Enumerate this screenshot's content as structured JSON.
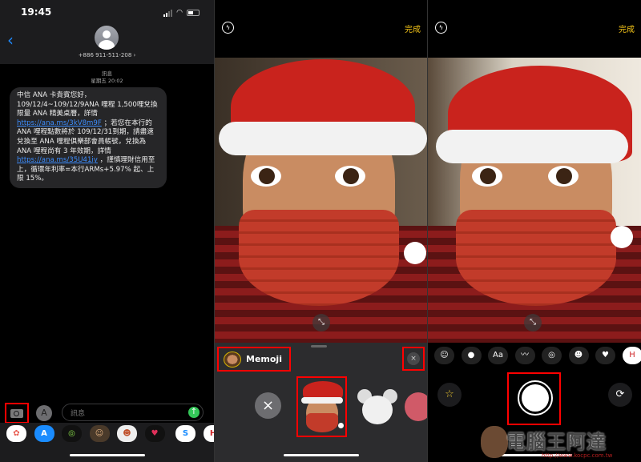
{
  "status_bar": {
    "time": "19:45"
  },
  "conversation": {
    "phone": "+886 911-511-208 ›",
    "back": "‹",
    "service": "訊息",
    "timestamp": "星期五 20:02"
  },
  "message": {
    "p1": "中信 ANA 卡貴賓您好，109/12/4~109/12/9ANA 哩程 1,500哩兌換限量 ANA 精美桌曆，詳情 ",
    "link1": "https://ana.ms/3kV8m9F",
    "p2": " ；若您在本行的ANA 哩程點數將於 109/12/31到期，請盡速兌換至 ANA 哩程俱樂部會員帳號，兌換為 ANA 哩程尚有 3 年效期，詳情 ",
    "link2": "https://ana.ms/35U41iy",
    "p3": " ，謹慎理財信用至上，循環年利率=本行ARMs+5.97% 起、上限 15%。"
  },
  "input": {
    "placeholder": "訊息",
    "send": "↑",
    "apps": "A"
  },
  "app_drawer": [
    {
      "name": "photos",
      "glyph": "✿",
      "bg": "#ffffff",
      "fg": "#e85a4f"
    },
    {
      "name": "app-store",
      "glyph": "A",
      "bg": "#1a8cff",
      "fg": "#ffffff"
    },
    {
      "name": "activity",
      "glyph": "◎",
      "bg": "#111111",
      "fg": "#8ae04a"
    },
    {
      "name": "memoji",
      "glyph": "☺",
      "bg": "#4a3a2a",
      "fg": "#e0b080"
    },
    {
      "name": "memoji-stickers",
      "glyph": "☻",
      "bg": "#eeeeee",
      "fg": "#c0502a"
    },
    {
      "name": "digital-touch",
      "glyph": "♥",
      "bg": "#111111",
      "fg": "#e0305a"
    },
    {
      "name": "shazam",
      "glyph": "S",
      "bg": "#ffffff",
      "fg": "#1a8cff"
    },
    {
      "name": "h-app",
      "glyph": "H",
      "bg": "#ffffff",
      "fg": "#d0282a"
    }
  ],
  "camera": {
    "done": "完成",
    "flash": "ϟ",
    "expand": "⤡"
  },
  "effects": {
    "title": "Memoji",
    "close": "×",
    "none": "×"
  },
  "camera_effects_row": [
    {
      "name": "memoji",
      "glyph": "☺"
    },
    {
      "name": "filters",
      "glyph": "●"
    },
    {
      "name": "text",
      "glyph": "Aa"
    },
    {
      "name": "shapes",
      "glyph": "〰"
    },
    {
      "name": "activity",
      "glyph": "◎"
    },
    {
      "name": "memoji-stickers",
      "glyph": "☻"
    },
    {
      "name": "emoji-stickers",
      "glyph": "♥"
    },
    {
      "name": "h-app",
      "glyph": "H"
    }
  ],
  "controls": {
    "effects": "☆",
    "flip": "⟳"
  },
  "watermark": {
    "name": "電腦王阿達",
    "url": "http://www.kocpc.com.tw"
  }
}
